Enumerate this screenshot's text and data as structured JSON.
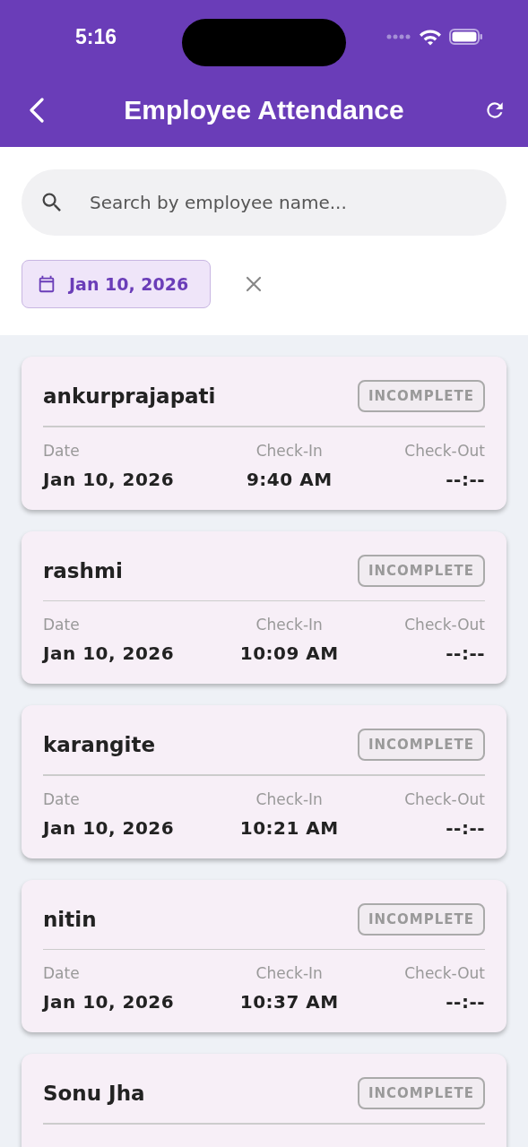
{
  "status_bar": {
    "time": "5:16"
  },
  "app_bar": {
    "title": "Employee Attendance"
  },
  "search": {
    "placeholder": "Search by employee name..."
  },
  "date_filter": {
    "label": "Jan 10, 2026"
  },
  "records": [
    {
      "name": "ankurprajapati",
      "status": "INCOMPLETE",
      "fields": [
        {
          "label": "Date",
          "value": "Jan 10, 2026"
        },
        {
          "label": "Check-In",
          "value": "9:40 AM"
        },
        {
          "label": "Check-Out",
          "value": "--:--"
        }
      ]
    },
    {
      "name": "rashmi",
      "status": "INCOMPLETE",
      "fields": [
        {
          "label": "Date",
          "value": "Jan 10, 2026"
        },
        {
          "label": "Check-In",
          "value": "10:09 AM"
        },
        {
          "label": "Check-Out",
          "value": "--:--"
        }
      ]
    },
    {
      "name": "karangite",
      "status": "INCOMPLETE",
      "fields": [
        {
          "label": "Date",
          "value": "Jan 10, 2026"
        },
        {
          "label": "Check-In",
          "value": "10:21 AM"
        },
        {
          "label": "Check-Out",
          "value": "--:--"
        }
      ]
    },
    {
      "name": "nitin",
      "status": "INCOMPLETE",
      "fields": [
        {
          "label": "Date",
          "value": "Jan 10, 2026"
        },
        {
          "label": "Check-In",
          "value": "10:37 AM"
        },
        {
          "label": "Check-Out",
          "value": "--:--"
        }
      ]
    },
    {
      "name": "Sonu Jha",
      "status": "INCOMPLETE"
    }
  ]
}
